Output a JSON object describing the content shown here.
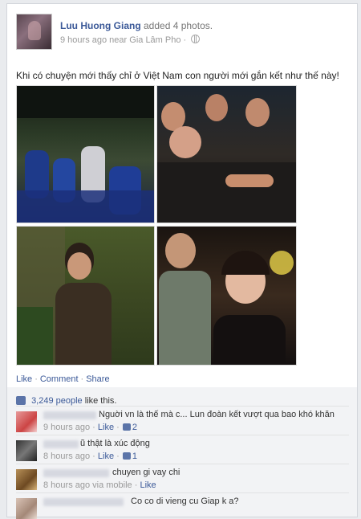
{
  "post": {
    "author": "Luu Huong Giang",
    "action": "added 4 photos.",
    "time": "9 hours ago",
    "location_prefix": "near",
    "location": "Gia Lâm Pho",
    "location_sep": "·",
    "message": "Khi có chuyện mới thấy chỉ ở Việt Nam con người mới gắn kết như thế này!"
  },
  "actions": {
    "like": "Like",
    "comment": "Comment",
    "share": "Share",
    "sep": "·"
  },
  "likes": {
    "count": "3,249 people",
    "suffix": "like this."
  },
  "comments": [
    {
      "text": "Nguời vn là thế mà c... Lun đoàn kết vượt qua bao khó khăn",
      "time": "9 hours ago",
      "sep": "·",
      "like": "Like",
      "sep2": "·",
      "likes": "2"
    },
    {
      "text": "ũ thật là xúc động",
      "time": "8 hours ago",
      "sep": "·",
      "like": "Like",
      "sep2": "·",
      "likes": "1"
    },
    {
      "text": "chuyen gi vay chi",
      "time": "8 hours ago via mobile",
      "sep": "·",
      "like": "Like"
    },
    {
      "text": "Co co di vieng cu Giap k a?"
    }
  ],
  "colors": {
    "link": "#3b5998",
    "meta": "#999999"
  }
}
